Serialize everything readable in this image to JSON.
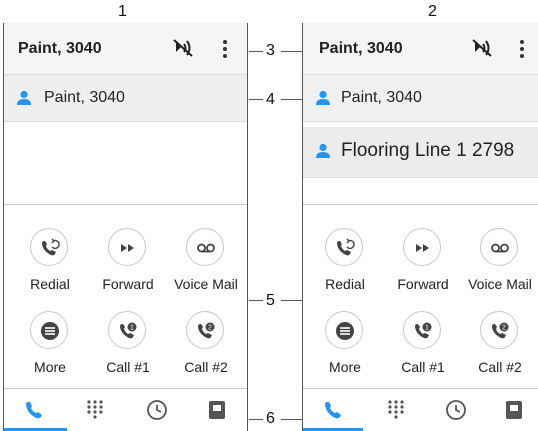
{
  "figure_labels": {
    "left": "1",
    "right": "2"
  },
  "callouts": [
    "3",
    "4",
    "5",
    "6"
  ],
  "colors": {
    "accent": "#2196F3",
    "icon_dark": "#444444",
    "bar_bg": "#F5F5F5"
  },
  "phone1": {
    "app_bar": {
      "title": "Paint, 3040",
      "mute_icon": "mute-mic-icon",
      "menu_icon": "more-vert-icon"
    },
    "contacts": [
      {
        "name": "Paint, 3040"
      }
    ],
    "buttons": [
      {
        "label": "Redial",
        "icon": "redial-icon"
      },
      {
        "label": "Forward",
        "icon": "forward-icon"
      },
      {
        "label": "Voice Mail",
        "icon": "voicemail-icon"
      },
      {
        "label": "More",
        "icon": "menu-icon"
      },
      {
        "label": "Call #1",
        "icon": "call-1-icon"
      },
      {
        "label": "Call #2",
        "icon": "call-2-icon"
      }
    ],
    "tabs": [
      {
        "icon": "phone-icon",
        "active": true
      },
      {
        "icon": "dialpad-icon",
        "active": false
      },
      {
        "icon": "clock-icon",
        "active": false
      },
      {
        "icon": "contacts-icon",
        "active": false
      }
    ]
  },
  "phone2": {
    "app_bar": {
      "title": "Paint, 3040",
      "mute_icon": "mute-mic-icon",
      "menu_icon": "more-vert-icon"
    },
    "contacts": [
      {
        "name": "Paint, 3040"
      },
      {
        "name": "Flooring Line 1 2798"
      }
    ],
    "buttons": [
      {
        "label": "Redial",
        "icon": "redial-icon"
      },
      {
        "label": "Forward",
        "icon": "forward-icon"
      },
      {
        "label": "Voice Mail",
        "icon": "voicemail-icon"
      },
      {
        "label": "More",
        "icon": "menu-icon"
      },
      {
        "label": "Call #1",
        "icon": "call-1-icon"
      },
      {
        "label": "Call #2",
        "icon": "call-2-icon"
      }
    ],
    "tabs": [
      {
        "icon": "phone-icon",
        "active": true
      },
      {
        "icon": "dialpad-icon",
        "active": false
      },
      {
        "icon": "clock-icon",
        "active": false
      },
      {
        "icon": "contacts-icon",
        "active": false
      }
    ]
  }
}
